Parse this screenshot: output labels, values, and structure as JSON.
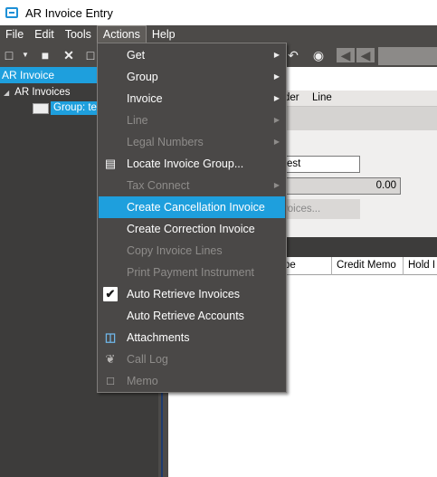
{
  "window": {
    "title": "AR Invoice Entry",
    "brand_color": "#1e9fdd"
  },
  "menubar": [
    "File",
    "Edit",
    "Tools",
    "Actions",
    "Help"
  ],
  "left_panel": {
    "header": "AR Invoice",
    "tree_root": "AR Invoices",
    "tree_child": "Group: tes"
  },
  "right_panel": {
    "tab_1": "der",
    "tab_2": "Line",
    "field_text": "est",
    "field_amount": "0.00",
    "button_text": "voices...",
    "col_type": "pe",
    "col_credit_memo": "Credit Memo",
    "col_hold": "Hold I"
  },
  "actions_menu": {
    "items": [
      {
        "label": "Get",
        "enabled": true,
        "submenu": true
      },
      {
        "label": "Group",
        "enabled": true,
        "submenu": true
      },
      {
        "label": "Invoice",
        "enabled": true,
        "submenu": true
      },
      {
        "label": "Line",
        "enabled": false,
        "submenu": true
      },
      {
        "label": "Legal Numbers",
        "enabled": false,
        "submenu": true
      },
      {
        "label": "Locate Invoice Group...",
        "enabled": true,
        "icon": "window-icon"
      },
      {
        "label": "Tax Connect",
        "enabled": false,
        "submenu": true
      },
      {
        "label": "Create Cancellation Invoice",
        "enabled": true,
        "highlighted": true
      },
      {
        "label": "Create Correction Invoice",
        "enabled": true
      },
      {
        "label": "Copy Invoice Lines",
        "enabled": false
      },
      {
        "label": "Print Payment Instrument",
        "enabled": false
      },
      {
        "label": "Auto Retrieve Invoices",
        "enabled": true,
        "checked": true
      },
      {
        "label": "Auto Retrieve Accounts",
        "enabled": true
      },
      {
        "label": "Attachments",
        "enabled": true,
        "icon": "attachment-icon"
      },
      {
        "label": "Call Log",
        "enabled": false,
        "icon": "phone-icon"
      },
      {
        "label": "Memo",
        "enabled": false,
        "icon": "memo-icon"
      }
    ]
  }
}
